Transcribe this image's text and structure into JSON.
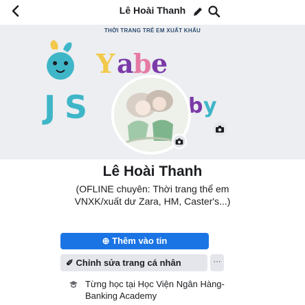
{
  "header": {
    "title": "Lê Hoài Thanh",
    "back_icon": "chevron-left-icon",
    "edit_icon": "pencil-icon",
    "search_icon": "search-icon"
  },
  "cover": {
    "caption": "THỜI TRANG TRẺ EM XUẤT KHẨU",
    "logo_text": "Yabe",
    "camera_icon": "camera-icon",
    "colors": {
      "teal": "#3fb6c8",
      "yellow": "#f2c94c",
      "purple": "#7b3aa8",
      "pink": "#e57ba5"
    }
  },
  "profile": {
    "name": "Lê Hoài Thanh",
    "bio": "(OFLINE chuyên: Thời trang thể em  VNXK/xuất dư Zara, HM, Caster's...)",
    "avatar_camera_icon": "camera-icon"
  },
  "actions": {
    "add_story_label": "⊕ Thêm vào tin",
    "edit_profile_label": "✐ Chỉnh sửa trang cá nhân",
    "more_label": "···"
  },
  "intro": {
    "education": "Từng học tại Học Viện Ngân Hàng-Banking Academy",
    "education_icon": "graduation-cap-icon"
  },
  "theme": {
    "primary": "#1b74e4",
    "button_gray": "#e4e6eb",
    "text": "#1c1e21"
  }
}
